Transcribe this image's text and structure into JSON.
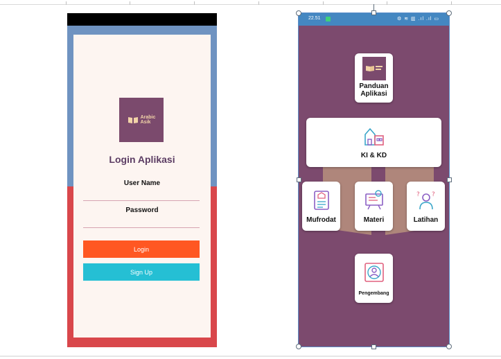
{
  "login_screen": {
    "logo_text_line1": "Arabic",
    "logo_text_line2": "Asik",
    "title": "Login Aplikasi",
    "username_label": "User Name",
    "password_label": "Password",
    "login_button": "Login",
    "signup_button": "Sign Up",
    "colors": {
      "login": "#ff5722",
      "signup": "#25bfd4",
      "title": "#5b3c63",
      "top_band": "#6f93c1",
      "bottom_band": "#d9474b"
    }
  },
  "menu_screen": {
    "status_time": "22.51",
    "status_icons": "⚙ ≋ ▥ .ıl .ıl ▭",
    "watermark_text": "Arabic Asik",
    "tiles": {
      "panduan": {
        "label_line1": "Panduan",
        "label_line2": "Aplikasi",
        "icon": "book-logo-icon"
      },
      "kikd": {
        "label": "KI & KD",
        "icon": "school-building-icon"
      },
      "mufrodat": {
        "label": "Mufrodat",
        "icon": "document-list-icon"
      },
      "materi": {
        "label": "Materi",
        "icon": "presentation-board-icon"
      },
      "latihan": {
        "label": "Latihan",
        "icon": "thinking-person-icon"
      },
      "pengembang": {
        "label": "Pengembang",
        "icon": "user-profile-icon"
      }
    },
    "colors": {
      "background": "#7c4a6e",
      "status_bar": "#4487c1"
    }
  }
}
